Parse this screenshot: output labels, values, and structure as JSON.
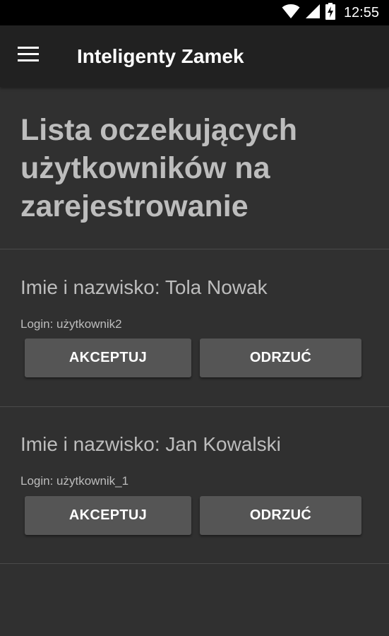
{
  "status_bar": {
    "time": "12:55",
    "icons": [
      "wifi-icon",
      "cell-signal-icon",
      "battery-charging-icon"
    ]
  },
  "app_bar": {
    "title": "Inteligenty Zamek",
    "menu_icon": "hamburger-menu-icon"
  },
  "page": {
    "title": "Lista oczekujących użytkowników na zarejestrowanie"
  },
  "users": [
    {
      "name_line": "Imie i nazwisko: Tola Nowak",
      "login_line": "Login: użytkownik2",
      "accept_label": "AKCEPTUJ",
      "reject_label": "ODRZUĆ"
    },
    {
      "name_line": "Imie i nazwisko: Jan Kowalski",
      "login_line": "Login: użytkownik_1",
      "accept_label": "AKCEPTUJ",
      "reject_label": "ODRZUĆ"
    }
  ],
  "colors": {
    "background": "#303030",
    "app_bar": "#212121",
    "status_bar": "#000000",
    "button": "#555555",
    "text_secondary": "#bdbdbd",
    "divider": "#4a4a4a"
  }
}
